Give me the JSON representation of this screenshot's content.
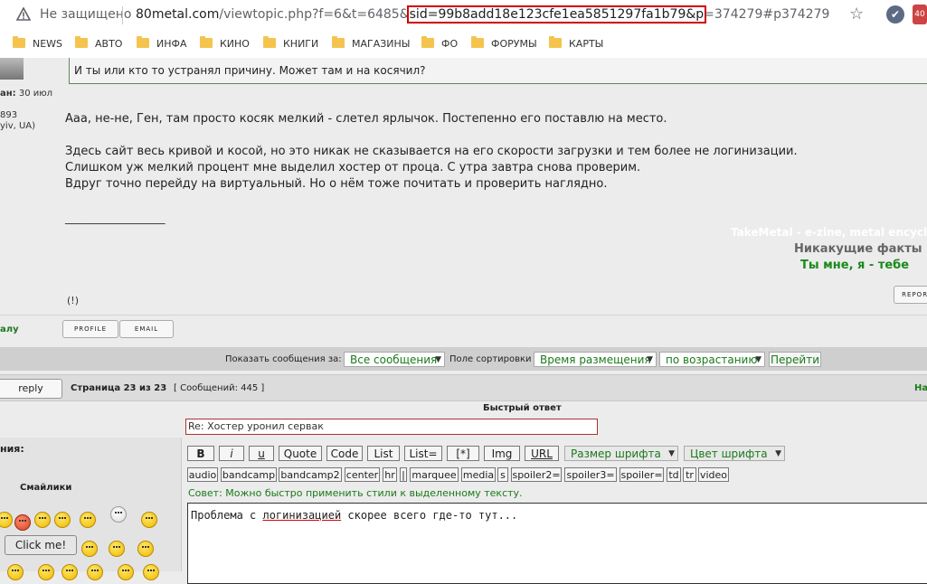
{
  "browser": {
    "security_label": "Не защищено",
    "url_domain": "80metal.com",
    "url_path": "/viewtopic.php?f=6&t=6485&",
    "url_sid": "sid=99b8add18e123cfe1ea5851297fa1b79&p",
    "url_tail": "=374279#p374279",
    "ext2_label": "40",
    "bookmarks": [
      {
        "label": "NEWS"
      },
      {
        "label": "АВТО"
      },
      {
        "label": "ИНФА"
      },
      {
        "label": "КИНО"
      },
      {
        "label": "КНИГИ"
      },
      {
        "label": "МАГАЗИНЫ"
      },
      {
        "label": "ФО"
      },
      {
        "label": "ФОРУМЫ"
      },
      {
        "label": "КАРТЫ"
      }
    ]
  },
  "post": {
    "author_joined_label": "ан:",
    "author_joined_value": "30 июл",
    "author_posts": "893",
    "author_location": "yiv, UA)",
    "quote_text": "И ты или кто то устранял причину. Может там и на косячил?",
    "lines": [
      "Ааа, не-не, Ген, там просто косяк мелкий - слетел ярлычок. Постепенно его поставлю на место.",
      "Здесь сайт весь кривой и косой, но это никак не сказывается на его скорости загрузки и тем более не логинизации.",
      "Слишком уж мелкий процент мне выделил хостер от проца. С утра завтра снова проверим.",
      "Вдруг точно перейду на виртуальный. Но о нём тоже почитать и проверить наглядно."
    ],
    "signature_rule": "_________________",
    "signature": [
      "TakeMetal - e-zine, metal encyclopedia",
      "Никакущие факты",
      "Ты мне, я - тебе"
    ],
    "excl": "(!)",
    "report_label": "REPORT",
    "user_label": "алу",
    "profile_label": "PROFILE",
    "email_label": "EMAIL"
  },
  "sort": {
    "show_label": "Показать сообщения за:",
    "show_value": "Все сообщения",
    "sort_label": "Поле сортировки",
    "sort_value": "Время размещения",
    "order_value": "по возрастанию",
    "go_label": "Перейти"
  },
  "pagination": {
    "reply_label": "reply",
    "page_text": "Страница 23 из 23",
    "count_text": "[ Сообщений: 445 ]",
    "right_text": "На"
  },
  "quick_reply": {
    "title": "Быстрый ответ",
    "subject": "Re: Хостер уронил сервак",
    "message_label": "ния:",
    "smilies_label": "Смайлики",
    "click_me": "Click me!",
    "format_buttons": [
      "B",
      "i",
      "u",
      "Quote",
      "Code",
      "List",
      "List=",
      "[*]",
      "Img",
      "URL"
    ],
    "font_size": "Размер шрифта",
    "font_color": "Цвет шрифта",
    "tag_buttons": [
      "audio",
      "bandcamp",
      "bandcamp2",
      "center",
      "hr",
      "|",
      "marquee",
      "media",
      "s",
      "spoiler2=",
      "spoiler3=",
      "spoiler=",
      "td",
      "tr",
      "video"
    ],
    "tip": "Совет: Можно быстро применить стили к выделенному тексту.",
    "text_before": "Проблема с ",
    "text_underlined": "логинизацией",
    "text_after": " скорее всего где-то тут..."
  }
}
